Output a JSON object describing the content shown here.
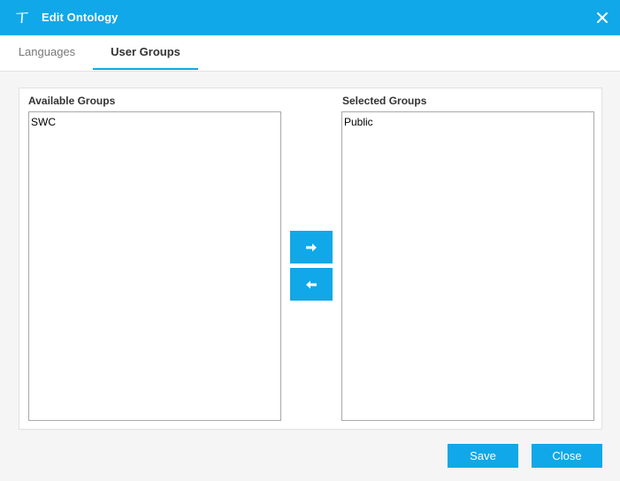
{
  "dialog": {
    "title": "Edit Ontology",
    "accent_color": "#10a8e8"
  },
  "tabs": [
    {
      "label": "Languages",
      "active": false
    },
    {
      "label": "User Groups",
      "active": true
    }
  ],
  "available": {
    "label": "Available Groups",
    "items": [
      "SWC"
    ]
  },
  "selected": {
    "label": "Selected Groups",
    "items": [
      "Public"
    ]
  },
  "move_buttons": {
    "add_icon": "arrow-right-icon",
    "remove_icon": "arrow-left-icon"
  },
  "footer": {
    "save_label": "Save",
    "close_label": "Close"
  }
}
